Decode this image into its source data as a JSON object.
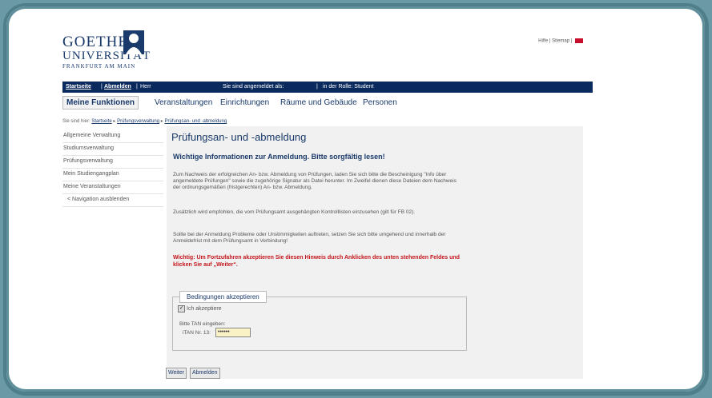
{
  "logo": {
    "line1": "GOETHE",
    "line2": "UNIVERSITÄT",
    "line3": "FRANKFURT AM MAIN"
  },
  "toplinks": {
    "help": "Hilfe",
    "sep": "|",
    "sitemap": "Sitemap"
  },
  "bar": {
    "home": "Startseite",
    "sep": "|",
    "logout": "Abmelden",
    "user": "Herr",
    "logged_in": "Sie sind angemeldet als:",
    "role": "in der Rolle: Student"
  },
  "nav": {
    "active": "Meine Funktionen",
    "items": [
      "Veranstaltungen",
      "Einrichtungen",
      "Räume und Gebäude",
      "Personen"
    ]
  },
  "breadcrumb": {
    "prefix": "Sie sind hier:",
    "home": "Startseite",
    "level1": "Prüfungsverwaltung",
    "level2": "Prüfungsan- und -abmeldung"
  },
  "sidebar": [
    "Allgemeine Verwaltung",
    "Studiumsverwaltung",
    "Prüfungsverwaltung",
    "Mein Studiengangplan",
    "Meine Veranstaltungen",
    "< Navigation ausblenden"
  ],
  "content": {
    "title": "Prüfungsan- und -abmeldung",
    "subtitle": "Wichtige Informationen zur Anmeldung. Bitte sorgfältig lesen!",
    "p1": "Zum Nachweis der erfolgreichen An- bzw. Abmeldung von Prüfungen, laden Sie sich bitte die Bescheinigung \"Info über angemeldete Prüfungen\" sowie die zugehörige Signatur als Datei herunter. Im Zweifel dienen diese Dateien dem Nachweis der ordnungsgemäßen (fristgerechten) An- bzw. Abmeldung.",
    "p2": "Zusätzlich wird empfohlen, die vom Prüfungsamt ausgehängten Kontrolllisten einzusehen (gilt für FB 02).",
    "p3": "Sollte bei der Anmeldung Probleme oder Unstimmigkeiten auftreten, setzen Sie sich bitte umgehend und innerhalb der Anmeldefrist mit dem Prüfungsamt in Verbindung!",
    "warning": "Wichtig: Um Fortzufahren akzeptieren Sie diesen Hinweis durch Anklicken des unten stehenden Feldes und klicken Sie auf „Weiter“."
  },
  "form": {
    "legend": "Bedingungen akzeptieren",
    "checkbox_label": "Ich akzeptiere",
    "tan_label": "Bitte TAN eingeben:",
    "tan_nr": "iTAN Nr. 13:",
    "tan_value": "••••••"
  },
  "buttons": {
    "next": "Weiter",
    "logout": "Abmelden"
  },
  "colors": {
    "navy": "#0a2a5e",
    "warning": "#c4161c",
    "frame": "#6b9aa6"
  }
}
